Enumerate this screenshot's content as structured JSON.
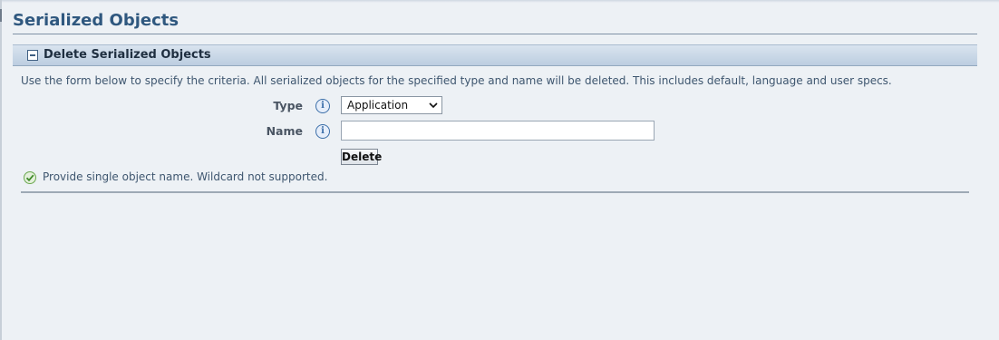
{
  "page": {
    "title": "Serialized Objects"
  },
  "section": {
    "title": "Delete Serialized Objects",
    "collapse_icon": "minus-box-icon"
  },
  "instructions": "Use the form below to specify the criteria. All serialized objects for the specified type and name will be deleted. This includes default, language and user specs.",
  "form": {
    "type_label": "Type",
    "type_value": "Application",
    "name_label": "Name",
    "name_value": "",
    "info_icon_glyph": "i",
    "delete_label": "Delete"
  },
  "hint": {
    "icon": "check-circle-icon",
    "text": "Provide single object name. Wildcard not supported."
  },
  "colors": {
    "title": "#2f587f",
    "section_header": "#bccde0",
    "background": "#edf1f5",
    "info_icon": "#3b6ea8",
    "check_icon": "#4f9a34"
  }
}
